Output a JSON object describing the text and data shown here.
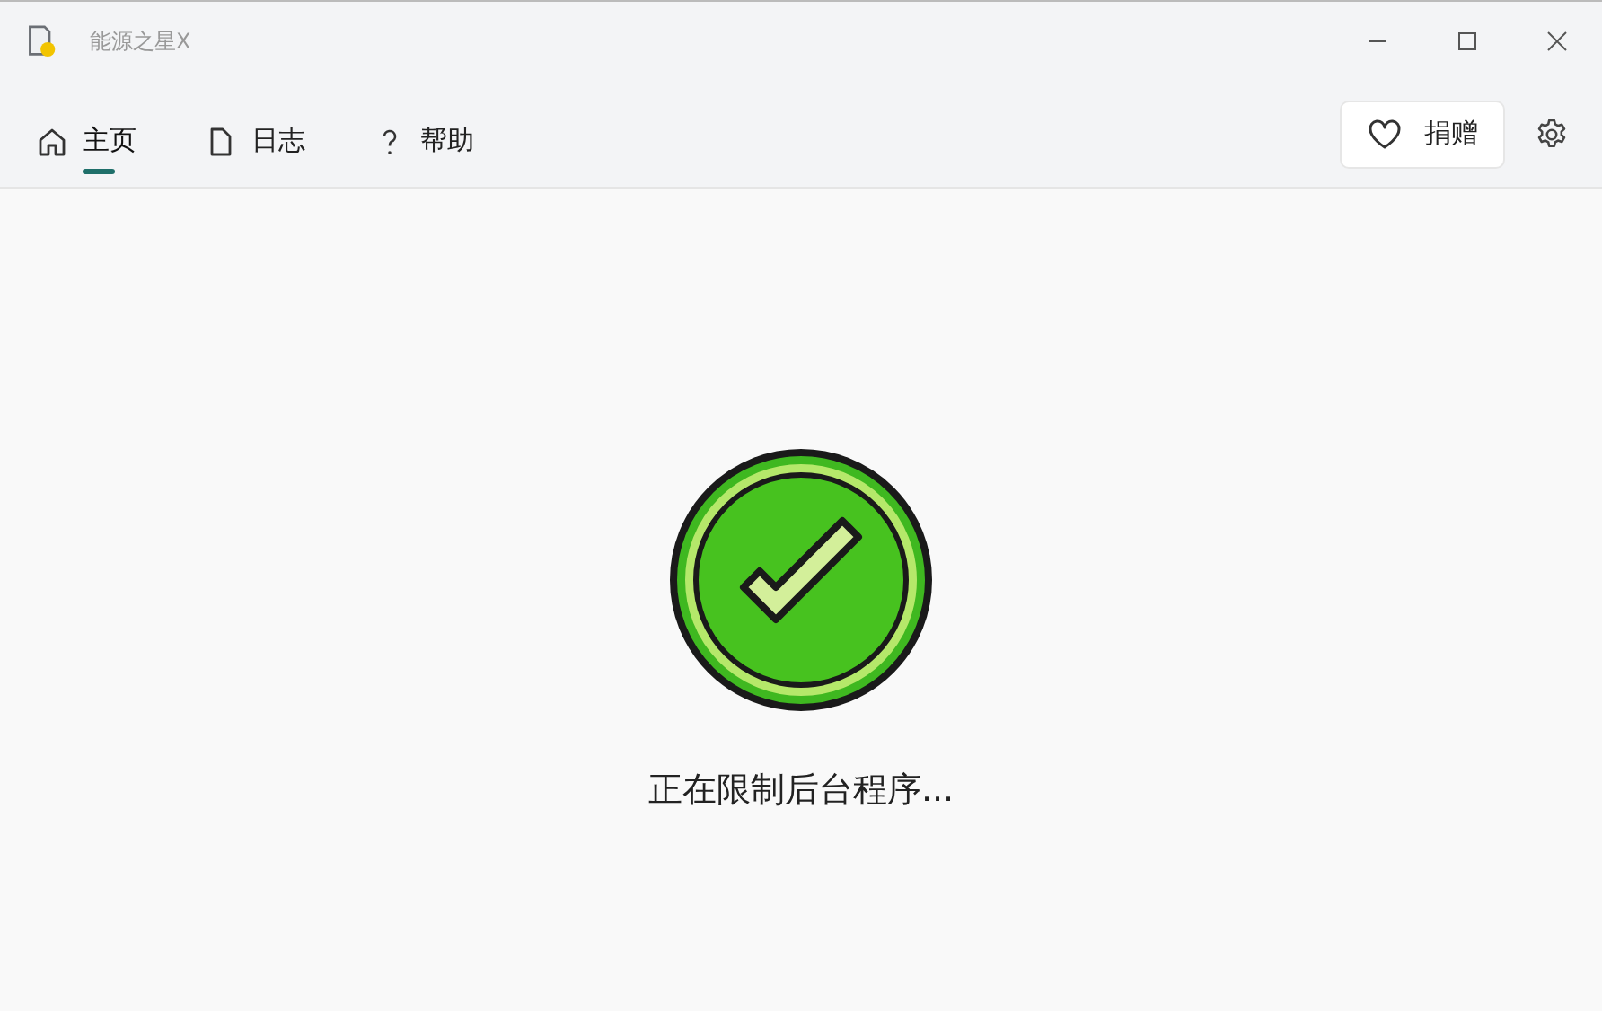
{
  "window": {
    "title": "能源之星X"
  },
  "tabs": [
    {
      "label": "主页",
      "kind": "home",
      "selected": true
    },
    {
      "label": "日志",
      "kind": "log",
      "selected": false
    },
    {
      "label": "帮助",
      "kind": "help",
      "selected": false
    }
  ],
  "donate_button": {
    "label": "捐赠"
  },
  "status": {
    "message": "正在限制后台程序..."
  }
}
